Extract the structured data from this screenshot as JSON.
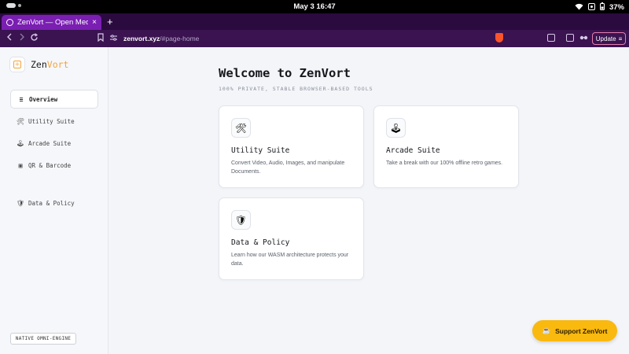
{
  "status_bar": {
    "clock": "May 3  16:47",
    "battery": "37%"
  },
  "browser": {
    "tab_title": "ZenVort — Open Media",
    "tab_close": "×",
    "new_tab": "+",
    "url_host": "zenvort.xyz",
    "url_path": "/#page-home",
    "update_label": "Update",
    "update_menu": "≡"
  },
  "sidebar": {
    "brand_prefix": "Zen",
    "brand_accent": "Vort",
    "items": [
      {
        "icon": "≡",
        "label": "Overview"
      },
      {
        "icon": "🛠",
        "label": "Utility Suite"
      },
      {
        "icon": "🕹",
        "label": "Arcade Suite"
      },
      {
        "icon": "▣",
        "label": "QR & Barcode"
      },
      {
        "icon": "🛡",
        "label": "Data & Policy"
      }
    ],
    "engine_label": "NATIVE OMNI-ENGINE"
  },
  "main": {
    "title": "Welcome to ZenVort",
    "subtitle": "100% PRIVATE, STABLE BROWSER-BASED TOOLS",
    "cards": [
      {
        "icon": "🛠",
        "title": "Utility Suite",
        "description": "Convert Video, Audio, Images, and manipulate Documents."
      },
      {
        "icon": "🕹",
        "title": "Arcade Suite",
        "description": "Take a break with our 100% offline retro games."
      },
      {
        "icon": "🛡",
        "title": "Data & Policy",
        "description": "Learn how our WASM architecture protects your data."
      }
    ]
  },
  "support": {
    "icon": "☕",
    "label": "Support ZenVort"
  },
  "colors": {
    "accent": "#f2a33a",
    "support_button": "#f9b90e",
    "tab_active": "#7a1fb2",
    "toolbar": "#3a1350"
  }
}
